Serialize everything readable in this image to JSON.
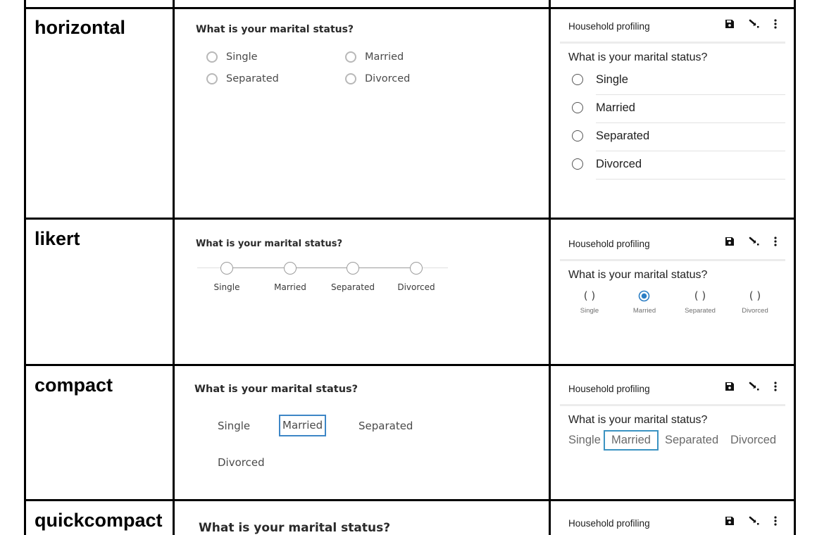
{
  "question": "What is your marital status?",
  "app_header": "Household profiling",
  "options": [
    "Single",
    "Married",
    "Separated",
    "Divorced"
  ],
  "selected_option": "Married",
  "rows": [
    {
      "label": "horizontal"
    },
    {
      "label": "likert"
    },
    {
      "label": "compact"
    },
    {
      "label": "quickcompact"
    }
  ],
  "icons": [
    "save-icon",
    "edit-arrow-icon",
    "more-vert-icon"
  ],
  "colors": {
    "border": "#000000",
    "selection_web": "#3d86c6",
    "selection_app": "#3b93c2",
    "radio_selected": "#2c7ec4"
  }
}
